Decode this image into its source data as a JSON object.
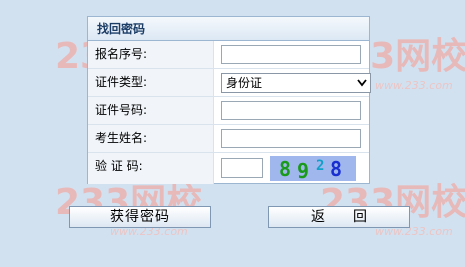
{
  "panel": {
    "title": "找回密码"
  },
  "form": {
    "registration_no_label": "报名序号:",
    "registration_no_value": "",
    "id_type_label": "证件类型:",
    "id_type_selected": "身份证",
    "id_no_label": "证件号码:",
    "id_no_value": "",
    "name_label": "考生姓名:",
    "name_value": "",
    "captcha_label": "验 证 码:",
    "captcha_value": "",
    "captcha_digits": [
      "8",
      "9",
      "2",
      "8"
    ],
    "captcha_colors": [
      "#1a9a1a",
      "#1a9a1a",
      "#12a0c8",
      "#1a2fd0"
    ]
  },
  "buttons": {
    "get_password": "获得密码",
    "back": "返回"
  },
  "watermark": {
    "brand": "233网校",
    "domain": "www.233.com"
  },
  "colors": {
    "page_bg": "#d2e1f0",
    "watermark": "#e0a8a8"
  }
}
